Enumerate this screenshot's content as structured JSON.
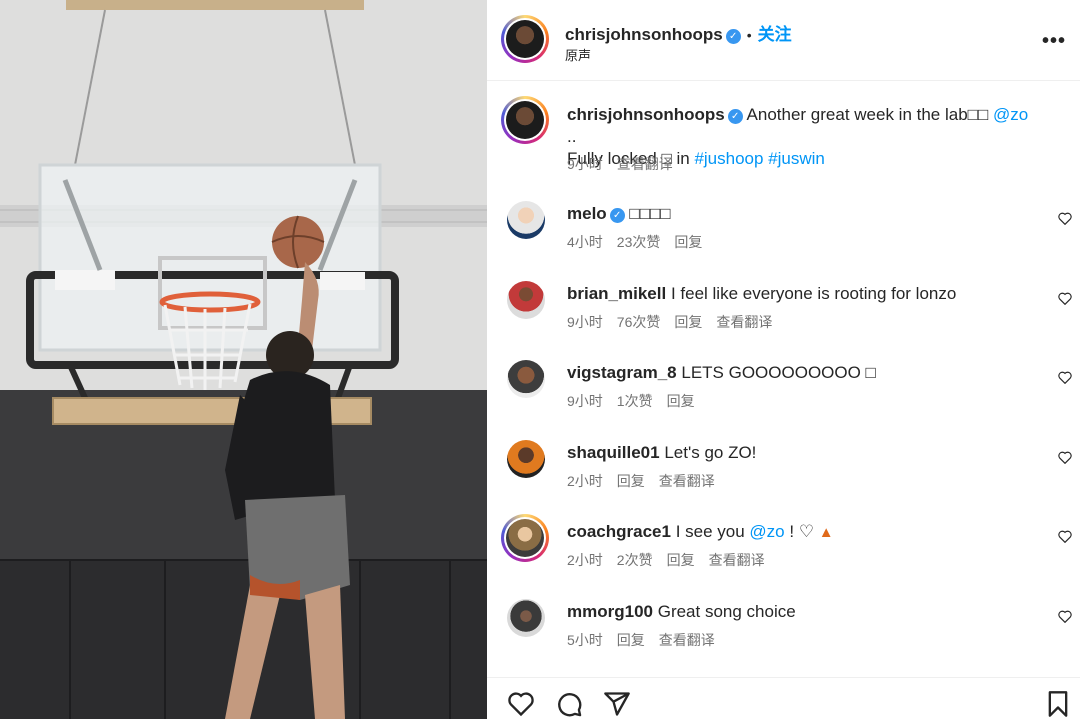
{
  "post": {
    "author": "chrisjohnsonhoops",
    "follow_label": "关注",
    "separator": "•",
    "audio_label": "原声",
    "caption_line1": "Another great week in the lab□□",
    "caption_mention": "@zo",
    "caption_ellipsis": "..",
    "caption_line2": "Fully locked □ in",
    "hashtag1": "#jushoop",
    "hashtag2": "#juswin",
    "time": "9小时",
    "translate_label": "查看翻译"
  },
  "labels": {
    "reply": "回复",
    "translate": "查看翻译",
    "more_icon": "more-horizontal-icon"
  },
  "comments": [
    {
      "user": "melo",
      "verified": true,
      "text": "□□□□",
      "time": "4小时",
      "likes": "23次赞",
      "reply": "回复",
      "translate": ""
    },
    {
      "user": "brian_mikell",
      "verified": false,
      "text": "I feel like everyone is rooting for lonzo",
      "time": "9小时",
      "likes": "76次赞",
      "reply": "回复",
      "translate": "查看翻译"
    },
    {
      "user": "vigstagram_8",
      "verified": false,
      "text": "LETS GOOOOOOOOO □",
      "time": "9小时",
      "likes": "1次赞",
      "reply": "回复",
      "translate": ""
    },
    {
      "user": "shaquille01",
      "verified": false,
      "text": "Let's go ZO!",
      "time": "2小时",
      "likes": "",
      "reply": "回复",
      "translate": "查看翻译"
    },
    {
      "user": "coachgrace1",
      "verified": false,
      "text_before": "I see you",
      "mention": "@zo",
      "text_after": "! ♡",
      "time": "2小时",
      "likes": "2次赞",
      "reply": "回复",
      "translate": "查看翻译"
    },
    {
      "user": "mmorg100",
      "verified": false,
      "text": "Great song choice",
      "time": "5小时",
      "likes": "",
      "reply": "回复",
      "translate": "查看翻译"
    }
  ],
  "colors": {
    "link": "#0095f6",
    "hashtag": "#00376b",
    "verified": "#3897f0",
    "muted": "#737373"
  },
  "icons": [
    "heart-icon",
    "comment-icon",
    "share-icon",
    "bookmark-icon",
    "more-horizontal-icon",
    "verified-badge-icon",
    "fire-icon"
  ]
}
